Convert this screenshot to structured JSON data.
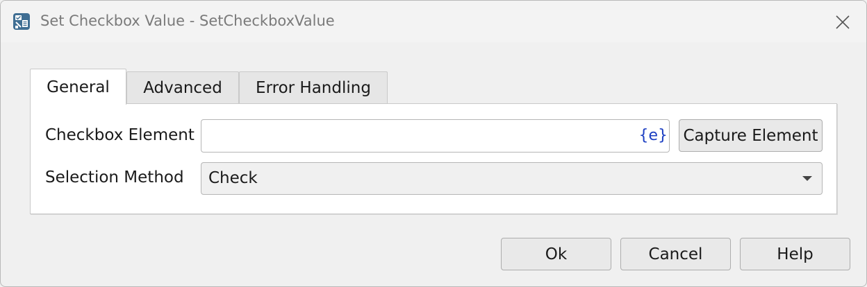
{
  "window": {
    "title": "Set Checkbox Value - SetCheckboxValue",
    "icon": "checkbox-action-icon",
    "close_icon": "close-icon"
  },
  "tabs": [
    {
      "label": "General",
      "active": true
    },
    {
      "label": "Advanced",
      "active": false
    },
    {
      "label": "Error Handling",
      "active": false
    }
  ],
  "general": {
    "checkbox_element_label": "Checkbox Element",
    "checkbox_element_value": "",
    "variable_token": "{e}",
    "capture_button": "Capture Element",
    "selection_method_label": "Selection Method",
    "selection_method_value": "Check"
  },
  "footer": {
    "ok": "Ok",
    "cancel": "Cancel",
    "help": "Help"
  },
  "colors": {
    "background": "#f0f0f0",
    "panel": "#ffffff",
    "variable_token": "#1b3ec2"
  }
}
